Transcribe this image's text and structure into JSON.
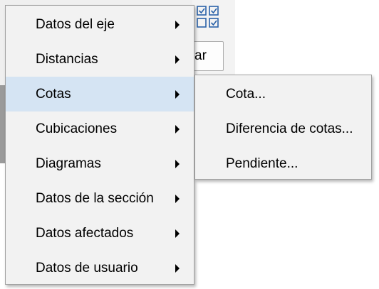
{
  "background": {
    "button_label": "ar",
    "icons": [
      "checkbox-grid-icon"
    ]
  },
  "main_menu": {
    "items": [
      {
        "label": "Datos del eje",
        "has_submenu": true,
        "highlighted": false
      },
      {
        "label": "Distancias",
        "has_submenu": true,
        "highlighted": false
      },
      {
        "label": "Cotas",
        "has_submenu": true,
        "highlighted": true
      },
      {
        "label": "Cubicaciones",
        "has_submenu": true,
        "highlighted": false
      },
      {
        "label": "Diagramas",
        "has_submenu": true,
        "highlighted": false
      },
      {
        "label": "Datos de la sección",
        "has_submenu": true,
        "highlighted": false
      },
      {
        "label": "Datos afectados",
        "has_submenu": true,
        "highlighted": false
      },
      {
        "label": "Datos de usuario",
        "has_submenu": true,
        "highlighted": false
      }
    ]
  },
  "sub_menu": {
    "items": [
      {
        "label": "Cota..."
      },
      {
        "label": "Diferencia de cotas..."
      },
      {
        "label": "Pendiente..."
      }
    ]
  },
  "colors": {
    "menu_background": "#f2f2f2",
    "highlight": "#d5e4f3",
    "border": "#a0a0a0",
    "icon_blue": "#2a62a8"
  }
}
